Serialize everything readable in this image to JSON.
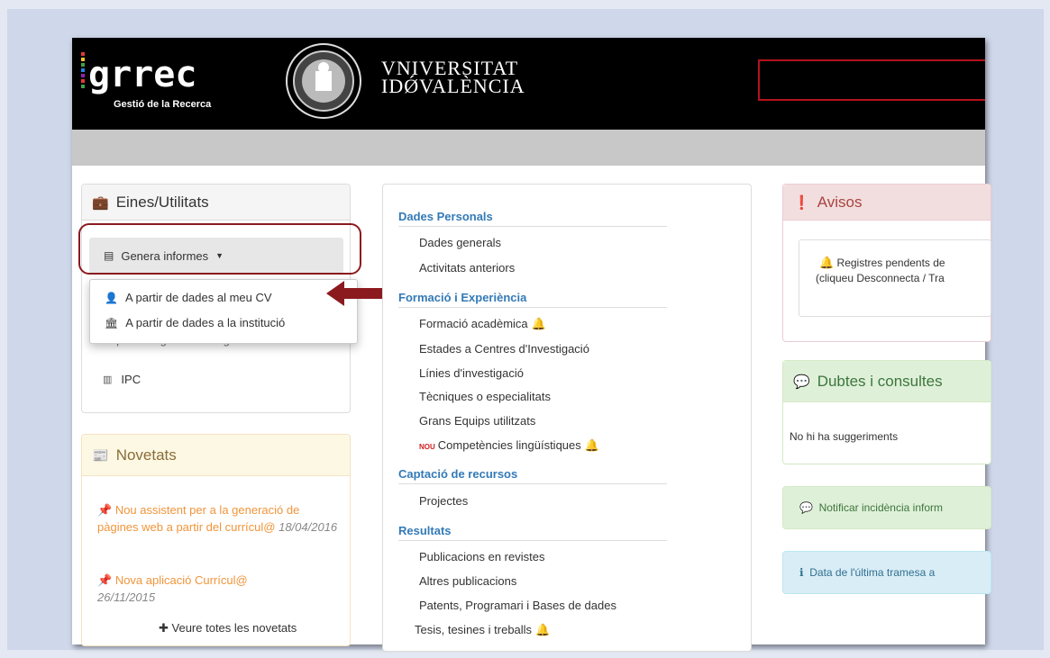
{
  "header": {
    "logo_text": "grrec",
    "logo_subtitle": "Gestió de la Recerca",
    "university_line1": "VNIVERSITAT",
    "university_line2": "IDǾVALÈNCIA"
  },
  "eines": {
    "title": "Eines/Utilitats",
    "genera_label": "Genera informes",
    "dropdown_items": [
      {
        "label": "A partir de dades al meu CV",
        "icon": "user-icon"
      },
      {
        "label": "A partir de dades a la institució",
        "icon": "institution-icon"
      }
    ],
    "exportar_label": "Exportar a gestor bibliogràfic",
    "ipc_label": "IPC"
  },
  "novetats": {
    "title": "Novetats",
    "items": [
      {
        "text": "Nou assistent per a la generació de pàgines web a partir del currícul@",
        "date": "18/04/2016"
      },
      {
        "text": "Nova aplicació Currícul@",
        "date": "26/11/2015"
      }
    ],
    "veure_label": "Veure totes les novetats"
  },
  "mid": {
    "sections": [
      {
        "title": "Dades Personals",
        "items": [
          "Dades generals",
          "Activitats anteriors"
        ]
      },
      {
        "title": "Formació i Experiència",
        "items": [
          "Formació acadèmica",
          "Estades a Centres d'Investigació",
          "Línies d'investigació",
          "Tècniques o especialitats",
          "Grans Equips utilitzats",
          "Competències lingüístiques"
        ]
      },
      {
        "title": "Captació de recursos",
        "items": [
          "Projectes"
        ]
      },
      {
        "title": "Resultats",
        "items": [
          "Publicacions en revistes",
          "Altres publicacions",
          "Patents, Programari i Bases de dades",
          "Tesis, tesines i treballs"
        ]
      }
    ],
    "nou_badge": "NOU"
  },
  "right": {
    "avisos_title": "Avisos",
    "avisos_line1": "Registres pendents de",
    "avisos_line2": "(cliqueu Desconnecta / Tra",
    "dubtes_title": "Dubtes i consultes",
    "dubtes_text": "No hi ha suggeriments",
    "notificar_text": "Notificar incidència inform",
    "data_text": "Data de l'última tramesa a"
  },
  "colors": {
    "highlight": "#8b1a1f",
    "link": "#337ab7",
    "bell": "#d04040"
  }
}
